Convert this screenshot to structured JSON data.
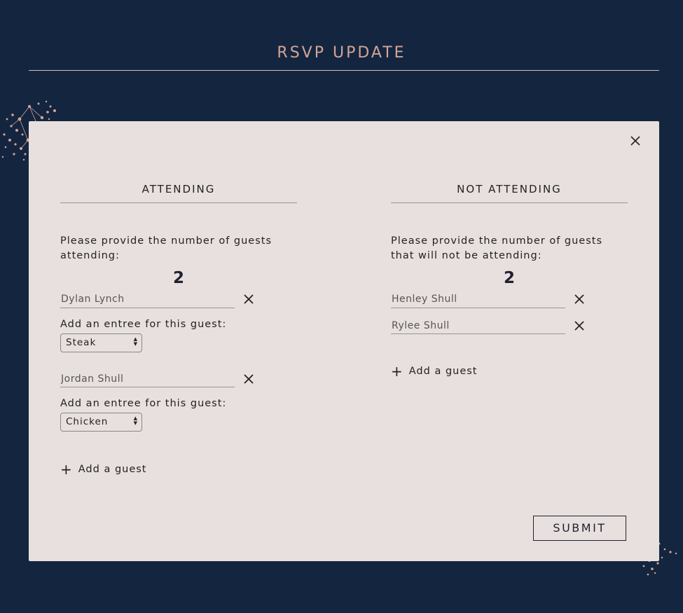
{
  "header": {
    "title": "RSVP UPDATE"
  },
  "attending": {
    "heading": "ATTENDING",
    "prompt": "Please provide the number of guests attending:",
    "count": "2",
    "guests": [
      {
        "name": "Dylan Lynch",
        "entree_label": "Add an entree for this guest:",
        "entree": "Steak"
      },
      {
        "name": "Jordan Shull",
        "entree_label": "Add an entree for this guest:",
        "entree": "Chicken"
      }
    ],
    "add_guest_label": "Add a guest"
  },
  "not_attending": {
    "heading": "NOT ATTENDING",
    "prompt": "Please provide the number of guests that will not be attending:",
    "count": "2",
    "guests": [
      {
        "name": "Henley Shull"
      },
      {
        "name": "Rylee Shull"
      }
    ],
    "add_guest_label": "Add a guest"
  },
  "actions": {
    "submit_label": "SUBMIT"
  },
  "colors": {
    "background": "#142540",
    "card": "#e8e0de",
    "accent": "#d4a596"
  },
  "icons": {
    "close": "close-icon",
    "remove": "x-icon",
    "add": "plus-icon"
  }
}
